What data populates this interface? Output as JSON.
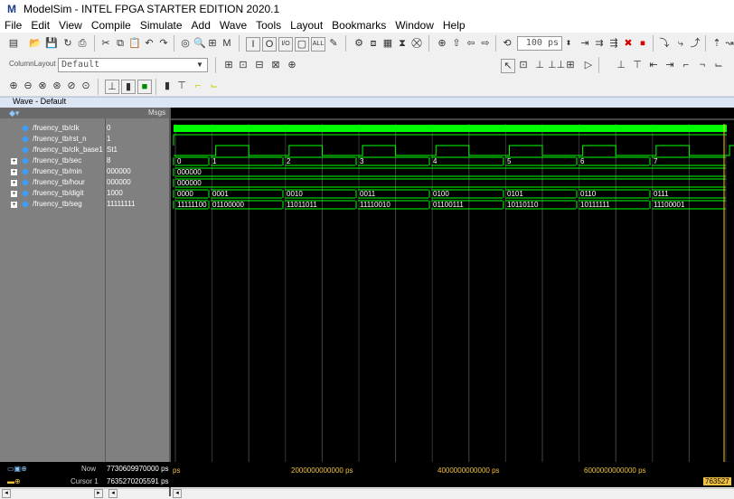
{
  "window": {
    "title": "ModelSim - INTEL FPGA STARTER EDITION 2020.1",
    "logo_letter": "M"
  },
  "menu": [
    "File",
    "Edit",
    "View",
    "Compile",
    "Simulate",
    "Add",
    "Wave",
    "Tools",
    "Layout",
    "Bookmarks",
    "Window",
    "Help"
  ],
  "toolbar": {
    "run_length": "100 ps",
    "column_layout_label": "ColumnLayout",
    "column_layout_value": "Default"
  },
  "wave_pane": {
    "title": "Wave - Default",
    "msgs_header": "Msgs"
  },
  "signals": [
    {
      "name": "/fruency_tb/clk",
      "value": "0",
      "expandable": false
    },
    {
      "name": "/fruency_tb/rst_n",
      "value": "1",
      "expandable": false
    },
    {
      "name": "/fruency_tb/clk_base1",
      "value": "St1",
      "expandable": false
    },
    {
      "name": "/fruency_tb/sec",
      "value": "8",
      "expandable": true
    },
    {
      "name": "/fruency_tb/min",
      "value": "000000",
      "expandable": true
    },
    {
      "name": "/fruency_tb/hour",
      "value": "000000",
      "expandable": true
    },
    {
      "name": "/fruency_tb/digit",
      "value": "1000",
      "expandable": true
    },
    {
      "name": "/fruency_tb/seg",
      "value": "11111111",
      "expandable": true
    }
  ],
  "buses": {
    "sec": [
      "0",
      "1",
      "2",
      "3",
      "4",
      "5",
      "6",
      "7"
    ],
    "min": [
      "000000"
    ],
    "hour": [
      "000000"
    ],
    "digit": [
      "0000",
      "0001",
      "0010",
      "0011",
      "0100",
      "0101",
      "0110",
      "0111"
    ],
    "seg": [
      "11111100",
      "01100000",
      "11011011",
      "11110010",
      "01100111",
      "10110110",
      "10111111",
      "11100001"
    ]
  },
  "status": {
    "now_label": "Now",
    "now_value": "7730609970000 ps",
    "cursor_label": "Cursor 1",
    "cursor_value": "7635270205591 ps",
    "cursor_tag": "763527",
    "time_ticks": [
      "ps",
      "2000000000000 ps",
      "4000000000000 ps",
      "6000000000000 ps"
    ]
  },
  "colors": {
    "wave_green": "#00ff00",
    "bus_text": "#ffffff",
    "background": "#000000"
  }
}
